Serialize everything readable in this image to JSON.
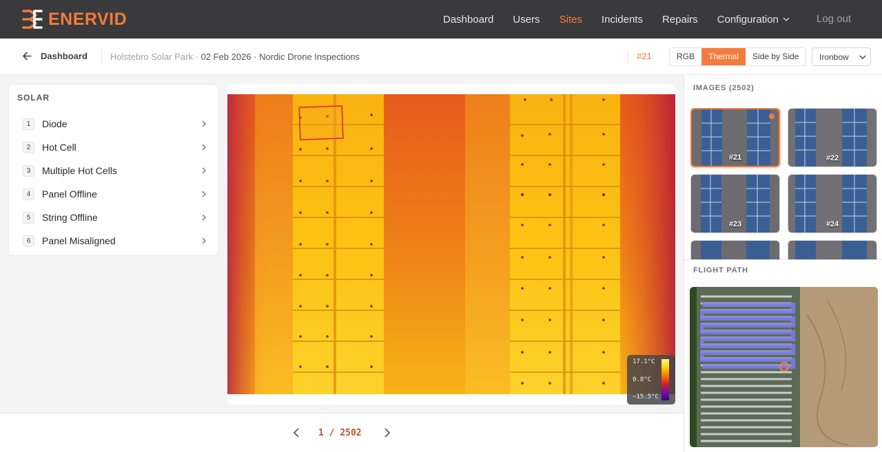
{
  "brand": {
    "name": "ENERVID",
    "color": "#f47b3e"
  },
  "nav": {
    "items": [
      {
        "label": "Dashboard",
        "active": false
      },
      {
        "label": "Users",
        "active": false
      },
      {
        "label": "Sites",
        "active": true
      },
      {
        "label": "Incidents",
        "active": false
      },
      {
        "label": "Repairs",
        "active": false
      },
      {
        "label": "Configuration",
        "active": false,
        "has_dropdown": true
      }
    ],
    "logout_label": "Log out"
  },
  "subheader": {
    "back_label": "Dashboard",
    "site": "Holstebro Solar Park",
    "separator": " · ",
    "date": "02 Feb 2026",
    "inspector": "Nordic Drone Inspections",
    "image_number": "#21",
    "view_modes": [
      {
        "label": "RGB",
        "active": false
      },
      {
        "label": "Thermal",
        "active": true
      },
      {
        "label": "Side by Side",
        "active": false
      }
    ],
    "palette": "Ironbow"
  },
  "categories": {
    "title": "SOLAR",
    "items": [
      {
        "num": "1",
        "label": "Diode"
      },
      {
        "num": "2",
        "label": "Hot Cell"
      },
      {
        "num": "3",
        "label": "Multiple Hot Cells"
      },
      {
        "num": "4",
        "label": "Panel Offline"
      },
      {
        "num": "5",
        "label": "String Offline"
      },
      {
        "num": "6",
        "label": "Panel Misaligned"
      }
    ]
  },
  "thermal_legend": {
    "max": "17.1°C",
    "mid": "0.8°C",
    "min": "−15.5°C"
  },
  "pager": {
    "current": "1",
    "separator": " / ",
    "total": "2502"
  },
  "images_panel": {
    "title": "IMAGES (2502)",
    "thumbs": [
      {
        "label": "#21",
        "active": true
      },
      {
        "label": "#22",
        "active": false
      },
      {
        "label": "#23",
        "active": false
      },
      {
        "label": "#24",
        "active": false
      },
      {
        "label": "",
        "active": false
      },
      {
        "label": "",
        "active": false
      }
    ]
  },
  "flight_path": {
    "title": "FLIGHT PATH"
  }
}
